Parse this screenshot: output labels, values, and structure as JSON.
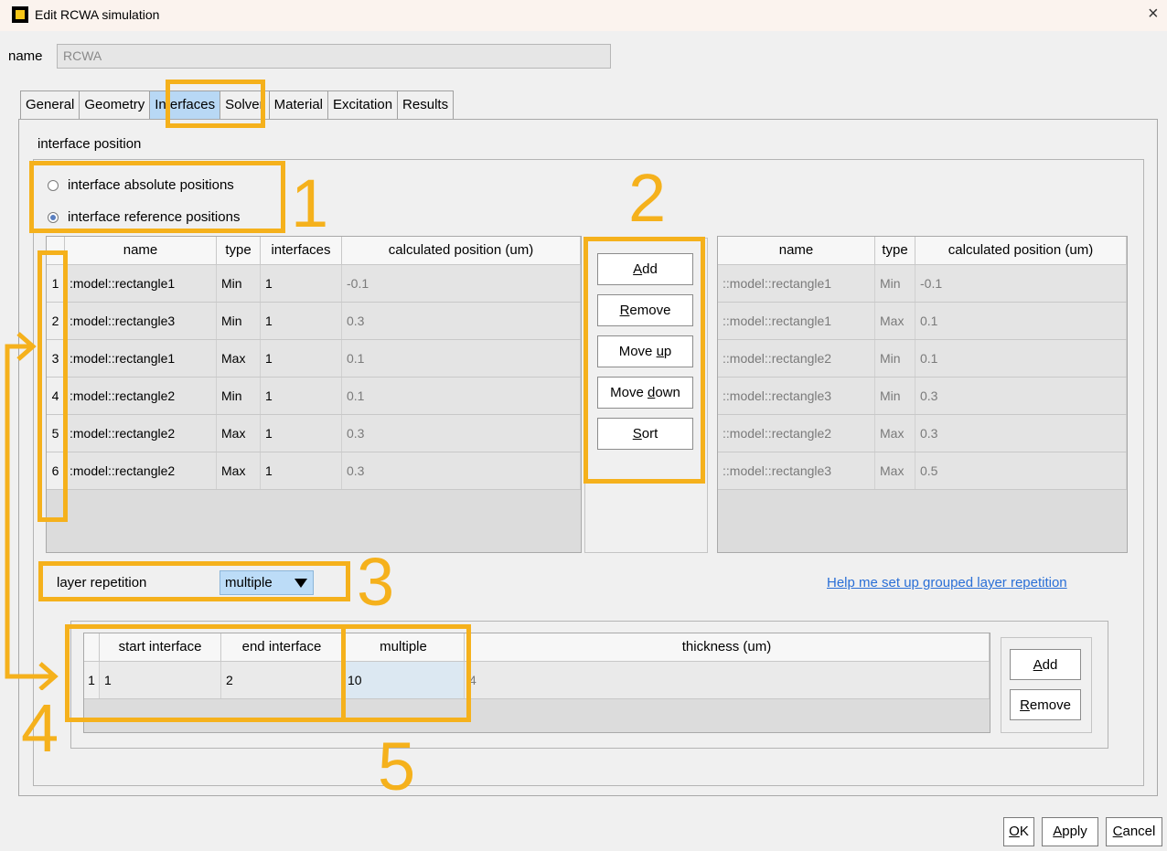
{
  "window": {
    "title": "Edit RCWA simulation",
    "close_glyph": "×"
  },
  "name_field": {
    "label": "name",
    "value": "RCWA"
  },
  "tabs": [
    {
      "label": "General"
    },
    {
      "label": "Geometry"
    },
    {
      "label": "Interfaces",
      "active": true
    },
    {
      "label": "Solver"
    },
    {
      "label": "Material"
    },
    {
      "label": "Excitation"
    },
    {
      "label": "Results"
    }
  ],
  "interface_position": {
    "section_label": "interface position",
    "radio_absolute": "interface absolute positions",
    "radio_reference": "interface reference positions",
    "selected": "reference"
  },
  "left_table": {
    "columns": [
      "name",
      "type",
      "interfaces",
      "calculated position (um)"
    ],
    "rows": [
      {
        "index": "1",
        "name": ":model::rectangle1",
        "type": "Min",
        "interfaces": "1",
        "position": "-0.1"
      },
      {
        "index": "2",
        "name": ":model::rectangle3",
        "type": "Min",
        "interfaces": "1",
        "position": "0.3"
      },
      {
        "index": "3",
        "name": ":model::rectangle1",
        "type": "Max",
        "interfaces": "1",
        "position": "0.1"
      },
      {
        "index": "4",
        "name": ":model::rectangle2",
        "type": "Min",
        "interfaces": "1",
        "position": "0.1"
      },
      {
        "index": "5",
        "name": ":model::rectangle2",
        "type": "Max",
        "interfaces": "1",
        "position": "0.3"
      },
      {
        "index": "6",
        "name": ":model::rectangle2",
        "type": "Max",
        "interfaces": "1",
        "position": "0.3"
      }
    ]
  },
  "middle_buttons": {
    "add": {
      "pre": "",
      "key": "A",
      "post": "dd"
    },
    "remove": {
      "pre": "",
      "key": "R",
      "post": "emove"
    },
    "move_up": {
      "pre": "Move ",
      "key": "u",
      "post": "p"
    },
    "move_down": {
      "pre": "Move ",
      "key": "d",
      "post": "own"
    },
    "sort": {
      "pre": "",
      "key": "S",
      "post": "ort"
    }
  },
  "right_table": {
    "columns": [
      "name",
      "type",
      "calculated position (um)"
    ],
    "rows": [
      {
        "name": "::model::rectangle1",
        "type": "Min",
        "position": "-0.1"
      },
      {
        "name": "::model::rectangle1",
        "type": "Max",
        "position": "0.1"
      },
      {
        "name": "::model::rectangle2",
        "type": "Min",
        "position": "0.1"
      },
      {
        "name": "::model::rectangle3",
        "type": "Min",
        "position": "0.3"
      },
      {
        "name": "::model::rectangle2",
        "type": "Max",
        "position": "0.3"
      },
      {
        "name": "::model::rectangle3",
        "type": "Max",
        "position": "0.5"
      }
    ]
  },
  "layer_repetition": {
    "label": "layer repetition",
    "value": "multiple",
    "help_link": "Help me set up grouped layer repetition"
  },
  "repetition_table": {
    "columns": [
      "start interface",
      "end interface",
      "multiple",
      "thickness (um)"
    ],
    "rows": [
      {
        "index": "1",
        "start": "1",
        "end": "2",
        "multiple": "10",
        "thickness": "4"
      }
    ]
  },
  "repetition_buttons": {
    "add": {
      "key": "A",
      "post": "dd"
    },
    "remove": {
      "key": "R",
      "post": "emove"
    }
  },
  "dialog_buttons": {
    "ok": {
      "key": "O",
      "post": "K"
    },
    "apply": {
      "key": "A",
      "post": "pply"
    },
    "cancel": {
      "key": "C",
      "post": "ancel"
    }
  },
  "annotations": {
    "highlight_color": "#f5b11c",
    "labels": [
      "1",
      "2",
      "3",
      "4",
      "5"
    ]
  }
}
